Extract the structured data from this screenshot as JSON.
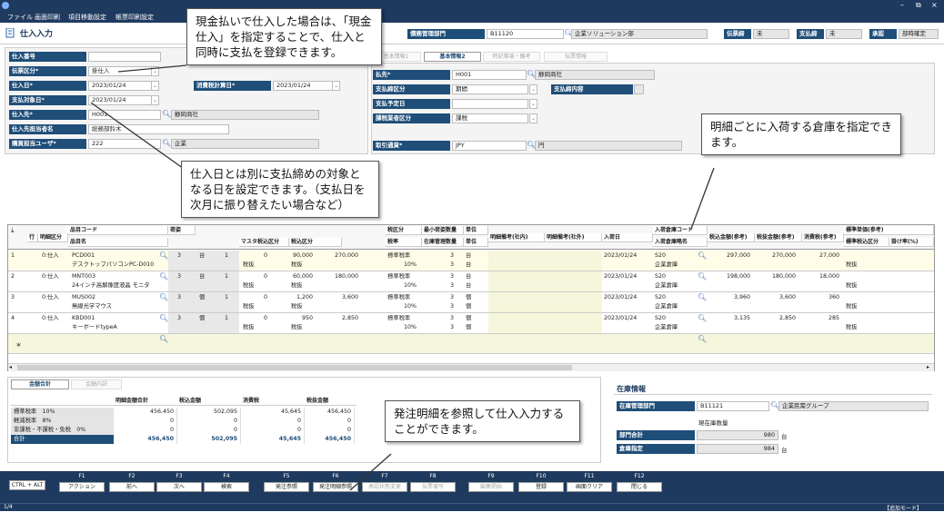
{
  "window": {
    "min": "–",
    "restore": "⧉",
    "close": "×"
  },
  "menu": [
    "ファイル",
    "画面印刷",
    "項目移動設定",
    "帳票印刷設定"
  ],
  "app": {
    "title": "仕入入力",
    "dept_label": "債務管理部門",
    "dept_code": "B11120",
    "dept_name": "企業ソリューション部",
    "unit_label": "伝票締",
    "unit_value": "未",
    "pay_label": "支払締",
    "pay_value": "未",
    "approve_label": "承認",
    "approve_value": "部時確定"
  },
  "header": {
    "fields": [
      {
        "label": "仕入番号",
        "value": ""
      },
      {
        "label": "伝票区分*",
        "value": "掛仕入"
      },
      {
        "label": "仕入日*",
        "value": "2023/01/24"
      },
      {
        "label": "支払対象日*",
        "value": "2023/01/24"
      },
      {
        "label": "仕入先*",
        "value": "H001",
        "name": "静岡商社"
      },
      {
        "label": "仕入先担当者名",
        "value": "総務部鈴木"
      },
      {
        "label": "購買担当ユーザ*",
        "value": "222",
        "name": "企業"
      }
    ],
    "tax_label": "消費税計算日*",
    "tax_value": "2023/01/24"
  },
  "tabs": [
    "基本情報1",
    "基本情報2",
    "特記事項・備考",
    "伝票情報"
  ],
  "right": {
    "fields": [
      {
        "label": "払先*",
        "value": "H001",
        "name": "静岡商社"
      },
      {
        "label": "支払締区分",
        "value": "期間"
      },
      {
        "label": "支払予定日",
        "value": ""
      },
      {
        "label": "課税業者区分",
        "value": "課税"
      },
      {
        "label": "取引通貨*",
        "value": "JPY",
        "name": "円"
      }
    ],
    "close_label": "支払締内容"
  },
  "grid": {
    "h1": [
      "行",
      "明細区分",
      "品目コード",
      "荷姿",
      "",
      "",
      "マスタ税込区分",
      "税込区分",
      "",
      "税区分",
      "最小荷姿数量",
      "単位",
      "明細備考(社内)",
      "明細備考(社外)",
      "入荷日",
      "入荷倉庫コード",
      "税込金額(参考)",
      "税抜金額(参考)",
      "消費税(参考)",
      "標準単価(参考)"
    ],
    "h2": [
      "品目名",
      "税率",
      "在庫管理数量",
      "単位",
      "入荷倉庫略名",
      "標準税込区分",
      "掛け率(%)"
    ],
    "rows": [
      {
        "no": "1",
        "kbn": "0:仕入",
        "code": "PCD001",
        "name": "デスクトップパソコンPC-D010",
        "qty": "3",
        "unit": "台",
        "pk": "1",
        "m0": "0",
        "m1": "90,000",
        "t1": "税抜",
        "t2": "税抜",
        "amt": "270,000",
        "tax": "標準税率",
        "rate": "10%",
        "q1": "3",
        "u1": "台",
        "q2": "3",
        "u2": "台",
        "date": "2023/01/24",
        "wh": "S20",
        "whn": "企業倉庫",
        "a1": "297,000",
        "a2": "270,000",
        "a3": "27,000",
        "st": "税抜"
      },
      {
        "no": "2",
        "kbn": "0:仕入",
        "code": "MNT003",
        "name": "24インチ高解像度液晶 モニタ",
        "qty": "3",
        "unit": "台",
        "pk": "1",
        "m0": "0",
        "m1": "60,000",
        "t1": "税抜",
        "t2": "税抜",
        "amt": "180,000",
        "tax": "標準税率",
        "rate": "10%",
        "q1": "3",
        "u1": "台",
        "q2": "3",
        "u2": "台",
        "date": "2023/01/24",
        "wh": "S20",
        "whn": "企業倉庫",
        "a1": "198,000",
        "a2": "180,000",
        "a3": "18,000",
        "st": "税抜"
      },
      {
        "no": "3",
        "kbn": "0:仕入",
        "code": "MUS002",
        "name": "無線光学マウス",
        "qty": "3",
        "unit": "個",
        "pk": "1",
        "m0": "0",
        "m1": "1,200",
        "t1": "税抜",
        "t2": "税抜",
        "amt": "3,600",
        "tax": "標準税率",
        "rate": "10%",
        "q1": "3",
        "u1": "個",
        "q2": "3",
        "u2": "個",
        "date": "2023/01/24",
        "wh": "S20",
        "whn": "企業倉庫",
        "a1": "3,960",
        "a2": "3,600",
        "a3": "360",
        "st": "税抜"
      },
      {
        "no": "4",
        "kbn": "0:仕入",
        "code": "KBD001",
        "name": "キーボードtypeA",
        "qty": "3",
        "unit": "個",
        "pk": "1",
        "m0": "0",
        "m1": "950",
        "t1": "税抜",
        "t2": "税抜",
        "amt": "2,850",
        "tax": "標準税率",
        "rate": "10%",
        "q1": "3",
        "u1": "個",
        "q2": "3",
        "u2": "個",
        "date": "2023/01/24",
        "wh": "S20",
        "whn": "企業倉庫",
        "a1": "3,135",
        "a2": "2,850",
        "a3": "285",
        "st": "税抜"
      }
    ],
    "new_marker": "＊"
  },
  "summary": {
    "tabs": [
      "金額合計",
      "金額内訳"
    ],
    "cols": [
      "明細金額合計",
      "税込金額",
      "消費税",
      "税抜金額"
    ],
    "rows": [
      {
        "label": "標準税率　10%",
        "v": [
          "456,450",
          "502,095",
          "45,645",
          "456,450"
        ]
      },
      {
        "label": "軽減税率　8%",
        "v": [
          "0",
          "0",
          "0",
          "0"
        ]
      },
      {
        "label": "非課税・不課税・免税　0%",
        "v": [
          "0",
          "0",
          "0",
          "0"
        ]
      },
      {
        "label": "合計",
        "v": [
          "456,450",
          "502,095",
          "45,645",
          "456,450"
        ]
      }
    ]
  },
  "stock": {
    "title": "在庫情報",
    "dept_label": "在庫管理部門",
    "dept_code": "B11121",
    "dept_name": "企業民需グループ",
    "current": "現在庫数量",
    "rows": [
      {
        "label": "部門合計",
        "value": "980",
        "unit": "台"
      },
      {
        "label": "倉庫指定",
        "value": "984",
        "unit": "台"
      }
    ]
  },
  "fkeys": {
    "ctrl": "CTRL + ALT",
    "keys": [
      {
        "fn": "F1",
        "label": "アクション",
        "on": true
      },
      {
        "fn": "F2",
        "label": "前へ",
        "on": true
      },
      {
        "fn": "F3",
        "label": "次へ",
        "on": true
      },
      {
        "fn": "F4",
        "label": "検索",
        "on": true
      },
      {
        "fn": "F5",
        "label": "発注参照",
        "on": true
      },
      {
        "fn": "F6",
        "label": "発注明細参照",
        "on": true
      },
      {
        "fn": "F7",
        "label": "承認状態変更",
        "on": false
      },
      {
        "fn": "F8",
        "label": "伝票複写",
        "on": false
      },
      {
        "fn": "F9",
        "label": "編集開始",
        "on": false
      },
      {
        "fn": "F10",
        "label": "登録",
        "on": true
      },
      {
        "fn": "F11",
        "label": "画面クリア",
        "on": true
      },
      {
        "fn": "F12",
        "label": "閉じる",
        "on": true
      }
    ]
  },
  "status": {
    "page": "1/4",
    "mode": "【追加モード】"
  },
  "callouts": [
    "現金払いで仕入した場合は、「現金仕入」を指定することで、仕入と同時に支払を登録できます。",
    "仕入日とは別に支払締めの対象となる日を設定できます。（支払日を次月に振り替えたい場合など）",
    "明細ごとに入荷する倉庫を指定できます。",
    "発注明細を参照して仕入入力することができます。"
  ]
}
